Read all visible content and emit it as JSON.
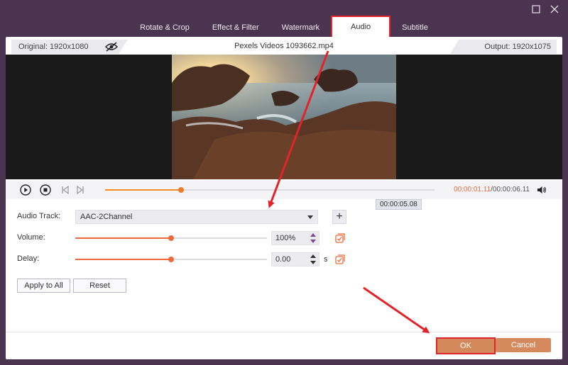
{
  "tabs": [
    {
      "label": "Rotate & Crop",
      "active": false
    },
    {
      "label": "Effect & Filter",
      "active": false
    },
    {
      "label": "Watermark",
      "active": false
    },
    {
      "label": "Audio",
      "active": true
    },
    {
      "label": "Subtitle",
      "active": false
    }
  ],
  "info": {
    "original": "Original: 1920x1080",
    "file_name": "Pexels Videos 1093662.mp4",
    "output": "Output: 1920x1075"
  },
  "player": {
    "current_time": "00:00:01.11",
    "total_time": "/00:00:06.11",
    "progress_fraction": 0.23,
    "tooltip_time": "00:00:05.08"
  },
  "audio": {
    "track_label": "Audio Track:",
    "track_value": "AAC-2Channel",
    "volume_label": "Volume:",
    "volume_value": "100%",
    "volume_fraction": 0.5,
    "delay_label": "Delay:",
    "delay_value": "0.00",
    "delay_unit": "s",
    "delay_fraction": 0.5
  },
  "buttons": {
    "apply_all": "Apply to All",
    "reset": "Reset",
    "ok": "OK",
    "cancel": "Cancel"
  },
  "colors": {
    "accent": "#ee6a3a",
    "highlight": "#e0242a",
    "button": "#d58a5e",
    "titlebar": "#4a3450"
  }
}
